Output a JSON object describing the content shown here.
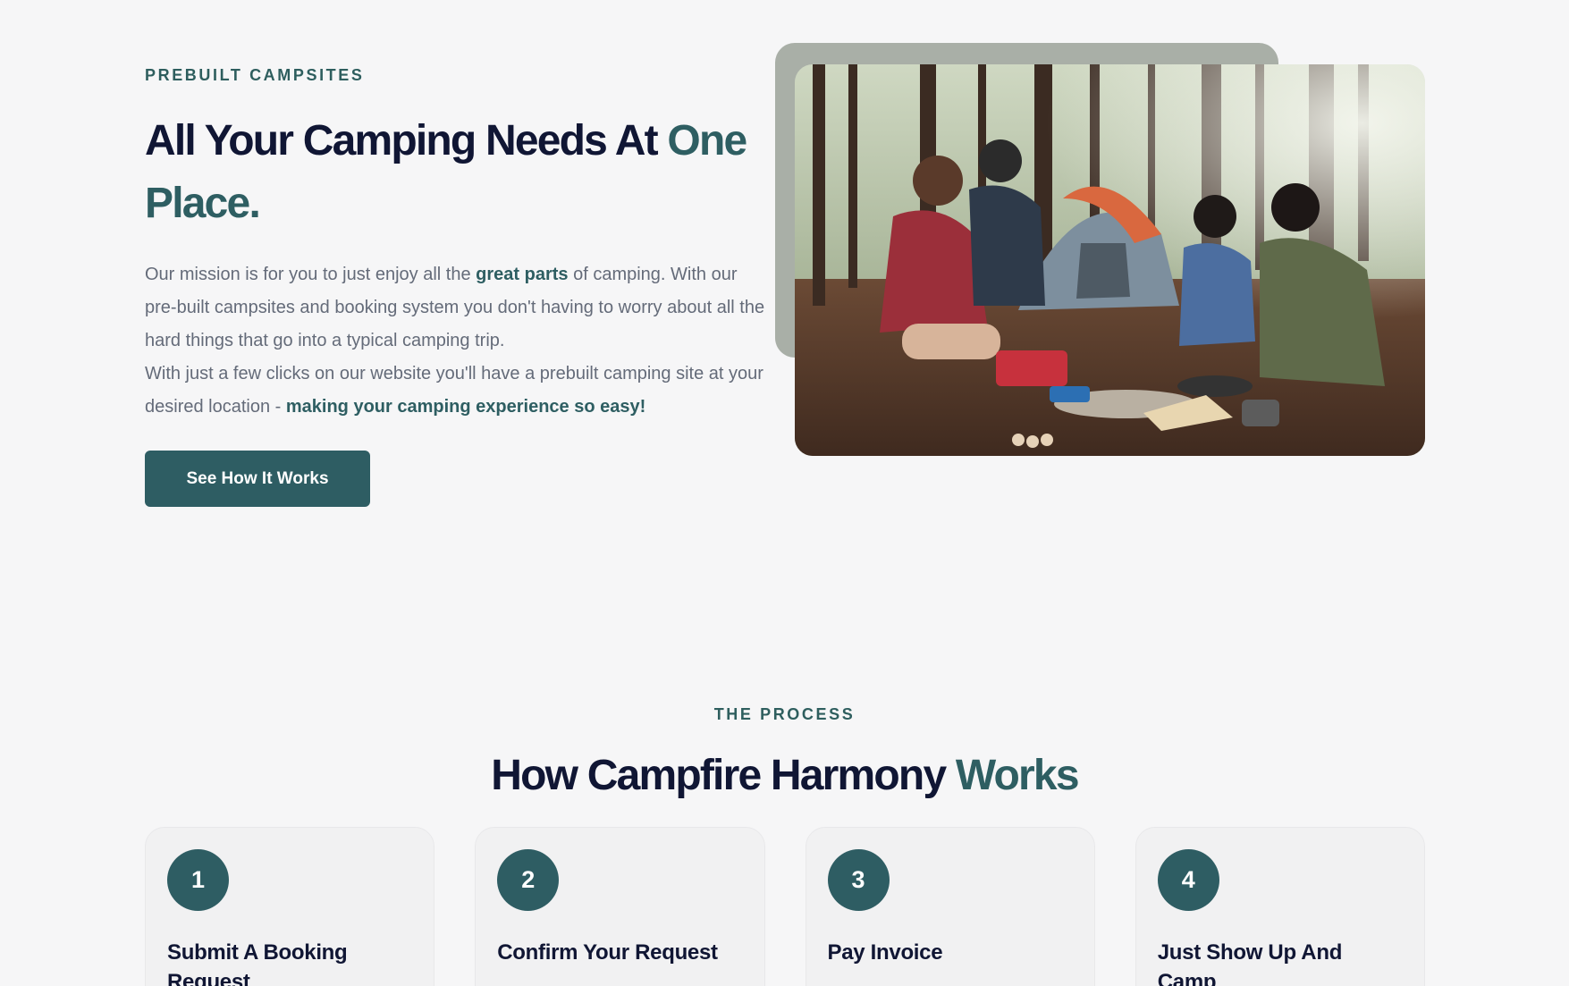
{
  "hero": {
    "eyebrow": "PREBUILT CAMPSITES",
    "title_main": "All Your Camping Needs At ",
    "title_accent": "One Place.",
    "body": {
      "p1_before": "Our mission is for you to just enjoy all the ",
      "p1_bold": "great parts",
      "p1_after": " of camping. With our pre-built campsites and booking system you don't having to worry about all the hard things that go into a typical camping trip.",
      "p2_before": "With just a few clicks on our website you'll have a prebuilt camping site at your desired location - ",
      "p2_bold": "making your camping experience so easy!"
    },
    "cta_label": "See How It Works",
    "photo_subject": "friends-cooking-at-campsite-photo"
  },
  "process": {
    "eyebrow": "THE PROCESS",
    "title_main": "How Campfire Harmony ",
    "title_accent": "Works",
    "steps": [
      {
        "number": "1",
        "title": "Submit A Booking Request"
      },
      {
        "number": "2",
        "title": "Confirm Your Request"
      },
      {
        "number": "3",
        "title": "Pay Invoice"
      },
      {
        "number": "4",
        "title": "Just Show Up And Camp"
      }
    ]
  },
  "colors": {
    "accent": "#2e5e62",
    "heading": "#101634",
    "body_text": "#646b79",
    "background": "#f6f6f7"
  }
}
